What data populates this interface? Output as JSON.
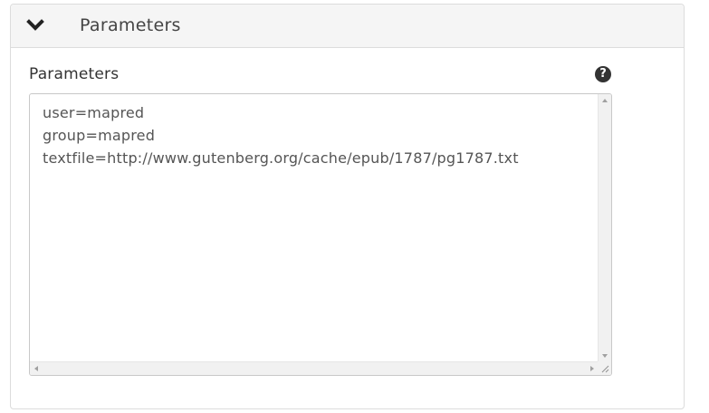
{
  "panel": {
    "title": "Parameters",
    "collapse_icon": "chevron-down-icon"
  },
  "field": {
    "label": "Parameters",
    "help_icon": "question-circle-icon",
    "help_glyph": "?",
    "value": "user=mapred\ngroup=mapred\ntextfile=http://www.gutenberg.org/cache/epub/1787/pg1787.txt"
  },
  "colors": {
    "header_bg": "#f5f5f5",
    "border": "#dcdcdc",
    "text": "#555555"
  }
}
